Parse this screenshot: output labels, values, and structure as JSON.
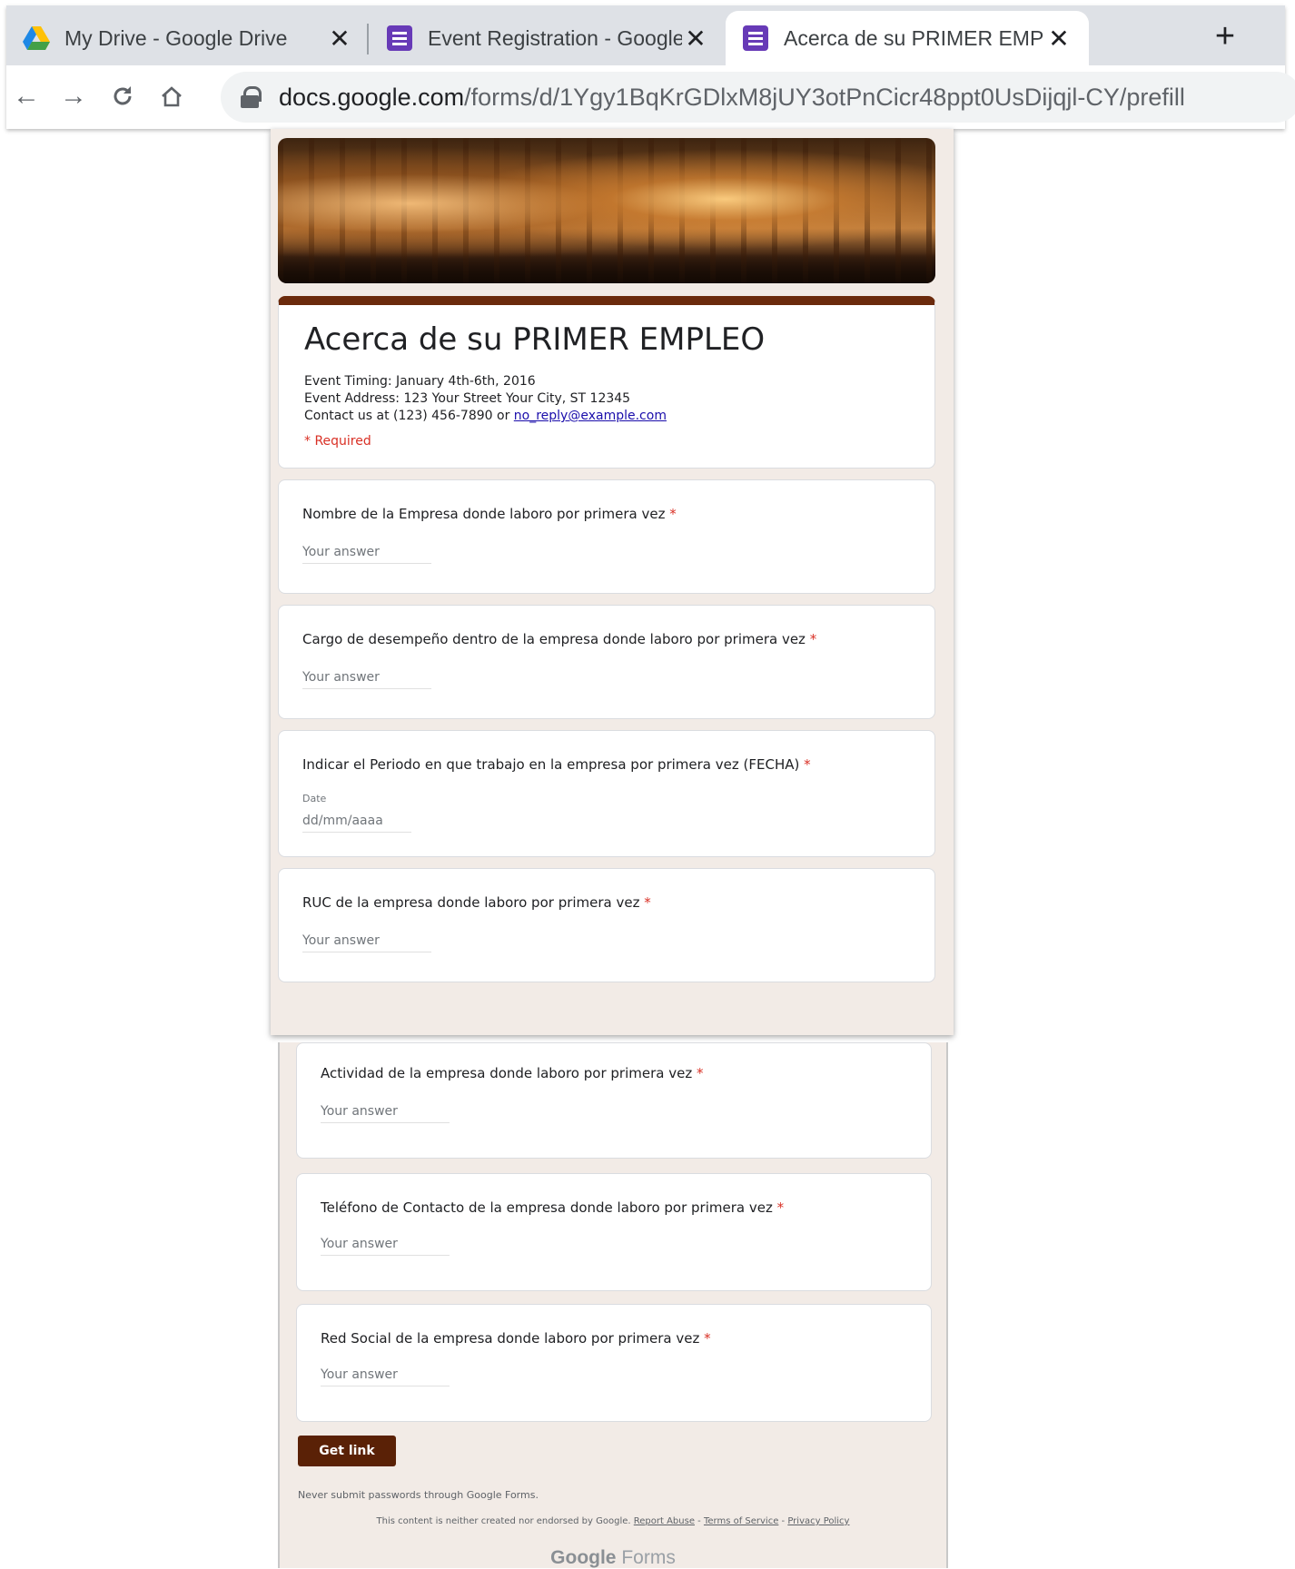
{
  "browser": {
    "tabs": [
      {
        "title": "My Drive - Google Drive",
        "icon": "google-drive-icon",
        "active": false
      },
      {
        "title": "Event Registration - Google Form",
        "icon": "google-forms-icon",
        "active": false
      },
      {
        "title": "Acerca de su PRIMER EMPLEO",
        "icon": "google-forms-icon",
        "active": true
      }
    ],
    "new_tab_label": "+",
    "url_host": "docs.google.com",
    "url_path": "/forms/d/1Ygy1BqKrGDlxM8jUY3otPnCicr48ppt0UsDijqjl-CY/prefill"
  },
  "form": {
    "title": "Acerca de su PRIMER EMPLEO",
    "description": {
      "line1": "Event Timing: January 4th-6th, 2016",
      "line2": "Event Address: 123 Your Street Your City, ST 12345",
      "line3_prefix": "Contact us at (123) 456-7890 or ",
      "line3_email": "no_reply@example.com"
    },
    "required_note": "* Required",
    "accent_color": "#6b2a0c",
    "questions": [
      {
        "title": "Nombre de la Empresa donde laboro por primera vez",
        "required_mark": " *",
        "type": "text",
        "placeholder": "Your answer"
      },
      {
        "title": "Cargo de desempeño dentro de la empresa donde laboro por primera vez",
        "required_mark": " *",
        "type": "text",
        "placeholder": "Your answer"
      },
      {
        "title": "Indicar el Periodo en que trabajo en la empresa por primera vez (FECHA)",
        "required_mark": " *",
        "type": "date",
        "date_label": "Date",
        "placeholder": "dd/mm/aaaa"
      },
      {
        "title": "RUC de la empresa donde laboro por primera vez",
        "required_mark": " *",
        "type": "text",
        "placeholder": "Your answer"
      },
      {
        "title": "Actividad de la empresa donde laboro por primera vez",
        "required_mark": " *",
        "type": "text",
        "placeholder": "Your answer"
      },
      {
        "title": "Teléfono de Contacto de la empresa donde laboro por primera vez",
        "required_mark": " *",
        "type": "text",
        "placeholder": "Your answer"
      },
      {
        "title": "Red Social de la empresa donde laboro por primera vez",
        "required_mark": " *",
        "type": "text",
        "placeholder": "Your answer"
      }
    ],
    "get_link_label": "Get link",
    "never_submit": "Never submit passwords through Google Forms.",
    "disclaimer": {
      "prefix": "This content is neither created nor endorsed by Google. ",
      "report_abuse": "Report Abuse",
      "sep1": " - ",
      "terms": "Terms of Service",
      "sep2": " - ",
      "privacy": "Privacy Policy"
    },
    "footer_logo_google": "Google",
    "footer_logo_forms": " Forms"
  }
}
